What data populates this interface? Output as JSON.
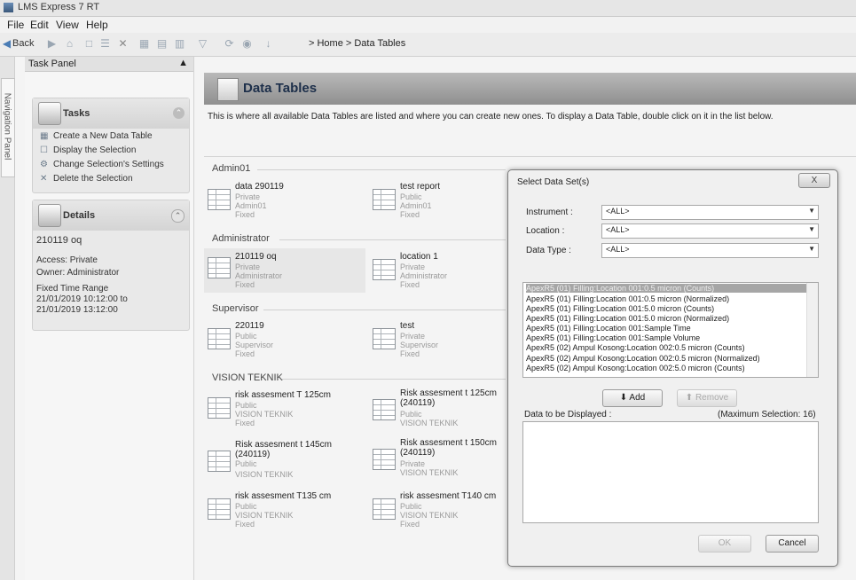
{
  "window": {
    "title": "LMS Express 7 RT"
  },
  "menu": [
    "File",
    "Edit",
    "View",
    "Help"
  ],
  "toolbar": {
    "back_label": "Back",
    "breadcrumb": "> Home > Data Tables"
  },
  "nav_panel": {
    "label": "Navigation Panel"
  },
  "task_panel": {
    "title": "Task Panel",
    "pin": "ɰ",
    "tasks": {
      "title": "Tasks",
      "items": [
        "Create a New Data Table",
        "Display the Selection",
        "Change Selection's Settings",
        "Delete the Selection"
      ]
    },
    "details": {
      "title": "Details",
      "name": "210119 oq",
      "access": "Access: Private",
      "owner": "Owner: Administrator",
      "range_label": "Fixed Time Range",
      "range_from": "21/01/2019 10:12:00 to",
      "range_to": "21/01/2019 13:12:00"
    }
  },
  "main": {
    "title": "Data Tables",
    "description": "This is where all available Data Tables are listed and where you can create new ones. To display a Data Table, double click on it in the list below.",
    "groups": [
      {
        "name": "Admin01",
        "items": [
          {
            "name": "data 290119",
            "access": "Private",
            "owner": "Admin01",
            "range": "Fixed"
          },
          {
            "name": "test report",
            "access": "Public",
            "owner": "Admin01",
            "range": "Fixed"
          }
        ]
      },
      {
        "name": "Administrator",
        "items": [
          {
            "name": "210119 oq",
            "access": "Private",
            "owner": "Administrator",
            "range": "Fixed"
          },
          {
            "name": "location 1",
            "access": "Private",
            "owner": "Administrator",
            "range": "Fixed"
          }
        ]
      },
      {
        "name": "Supervisor",
        "items": [
          {
            "name": "220119",
            "access": "Public",
            "owner": "Supervisor",
            "range": "Fixed"
          },
          {
            "name": "test",
            "access": "Private",
            "owner": "Supervisor",
            "range": "Fixed"
          }
        ]
      },
      {
        "name": "VISION TEKNIK",
        "items": [
          {
            "name": "risk assesment T 125cm",
            "access": "Public",
            "owner": "VISION TEKNIK",
            "range": "Fixed"
          },
          {
            "name": "Risk assesment t 125cm (240119)",
            "access": "Public",
            "owner": "VISION TEKNIK",
            "range": ""
          },
          {
            "name": "Risk assesment t 145cm (240119)",
            "access": "Public",
            "owner": "VISION TEKNIK",
            "range": ""
          },
          {
            "name": "Risk assesment t 150cm (240119)",
            "access": "Private",
            "owner": "VISION TEKNIK",
            "range": ""
          },
          {
            "name": "risk assesment T135 cm",
            "access": "Public",
            "owner": "VISION TEKNIK",
            "range": "Fixed"
          },
          {
            "name": "risk assesment T140 cm",
            "access": "Public",
            "owner": "VISION TEKNIK",
            "range": "Fixed"
          }
        ]
      }
    ]
  },
  "dialog": {
    "title": "Select Data Set(s)",
    "close": "X",
    "instrument_label": "Instrument :",
    "instrument_value": "<ALL>",
    "location_label": "Location :",
    "location_value": "<ALL>",
    "datatype_label": "Data Type :",
    "datatype_value": "<ALL>",
    "available": [
      "ApexR5 (01) Filling:Location 001:0.5 micron (Counts)",
      "ApexR5 (01) Filling:Location 001:0.5 micron (Normalized)",
      "ApexR5 (01) Filling:Location 001:5.0 micron (Counts)",
      "ApexR5 (01) Filling:Location 001:5.0 micron (Normalized)",
      "ApexR5 (01) Filling:Location 001:Sample Time",
      "ApexR5 (01) Filling:Location 001:Sample Volume",
      "ApexR5 (02) Ampul Kosong:Location 002:0.5 micron (Counts)",
      "ApexR5 (02) Ampul Kosong:Location 002:0.5 micron (Normalized)",
      "ApexR5 (02) Ampul Kosong:Location 002:5.0 micron (Counts)"
    ],
    "add_label": "Add",
    "remove_label": "Remove",
    "display_label": "Data to be Displayed :",
    "max_label": "(Maximum Selection: 16)",
    "ok_label": "OK",
    "cancel_label": "Cancel"
  }
}
